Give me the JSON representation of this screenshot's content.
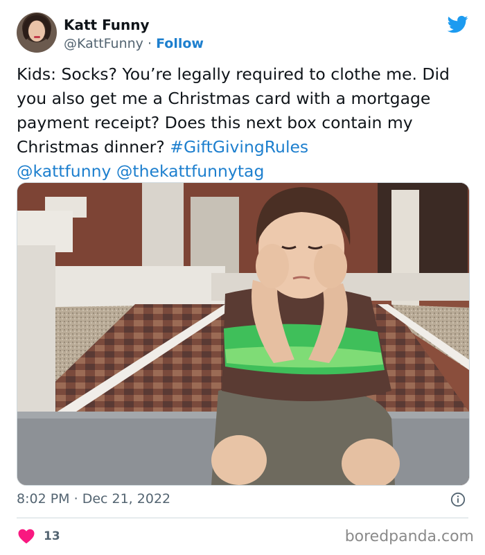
{
  "author": {
    "name": "Katt Funny",
    "handle": "@KattFunny",
    "separator": "·",
    "follow_label": "Follow"
  },
  "icons": {
    "brand": "twitter-bird-icon",
    "like": "heart-icon",
    "info": "info-icon",
    "brand_color": "#1d9bf0",
    "like_color": "#f91880",
    "link_color": "#1d7fce"
  },
  "tweet": {
    "text_plain": "Kids: Socks? You’re legally required to clothe me. Did you also get me a Christmas card with a mortgage payment receipt? Does this next box contain my Christmas dinner?",
    "hashtag": "#GiftGivingRules",
    "mention_1": "@kattfunny",
    "mention_2": "@thekattfunnytag"
  },
  "meta": {
    "time": "8:02 PM",
    "separator": "·",
    "date": "Dec 21, 2022"
  },
  "stats": {
    "likes": "13"
  },
  "watermark": "boredpanda.com"
}
